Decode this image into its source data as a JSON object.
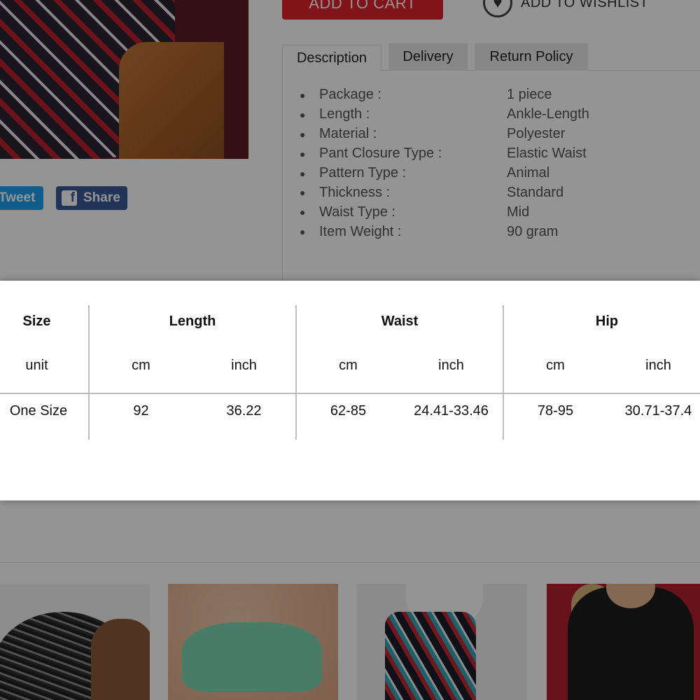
{
  "product": {
    "add_to_cart_label": "ADD TO CART",
    "wishlist_label": "ADD TO WISHLIST"
  },
  "social": {
    "tweet_label": "Tweet",
    "share_label": "Share"
  },
  "tabs": [
    {
      "label": "Description",
      "active": true
    },
    {
      "label": "Delivery",
      "active": false
    },
    {
      "label": "Return Policy",
      "active": false
    }
  ],
  "specs": [
    {
      "key": "Package :",
      "value": "1 piece"
    },
    {
      "key": "Length :",
      "value": "Ankle-Length"
    },
    {
      "key": "Material :",
      "value": "Polyester"
    },
    {
      "key": "Pant Closure Type :",
      "value": "Elastic Waist"
    },
    {
      "key": "Pattern Type :",
      "value": "Animal"
    },
    {
      "key": "Thickness :",
      "value": "Standard"
    },
    {
      "key": "Waist Type :",
      "value": "Mid"
    },
    {
      "key": "Item Weight :",
      "value": "90 gram"
    }
  ],
  "size_chart": {
    "headers": {
      "size": "Size",
      "length": "Length",
      "waist": "Waist",
      "hip": "Hip"
    },
    "units": {
      "label": "unit",
      "length_cm": "cm",
      "length_inch": "inch",
      "waist_cm": "cm",
      "waist_inch": "inch",
      "hip_cm": "cm",
      "hip_inch": "inch"
    },
    "row": {
      "size": "One Size",
      "length_cm": "92",
      "length_inch": "36.22",
      "waist_cm": "62-85",
      "waist_inch": "24.41-33.46",
      "hip_cm": "78-95",
      "hip_inch": "30.71-37.4"
    }
  },
  "colors": {
    "cart_red": "#e0212b",
    "twitter_blue": "#1da1f2",
    "facebook_blue": "#3b5998",
    "overlay": "rgba(0,0,0,0.42)"
  },
  "icons": {
    "wishlist": "heart-icon",
    "share": "facebook-icon"
  }
}
